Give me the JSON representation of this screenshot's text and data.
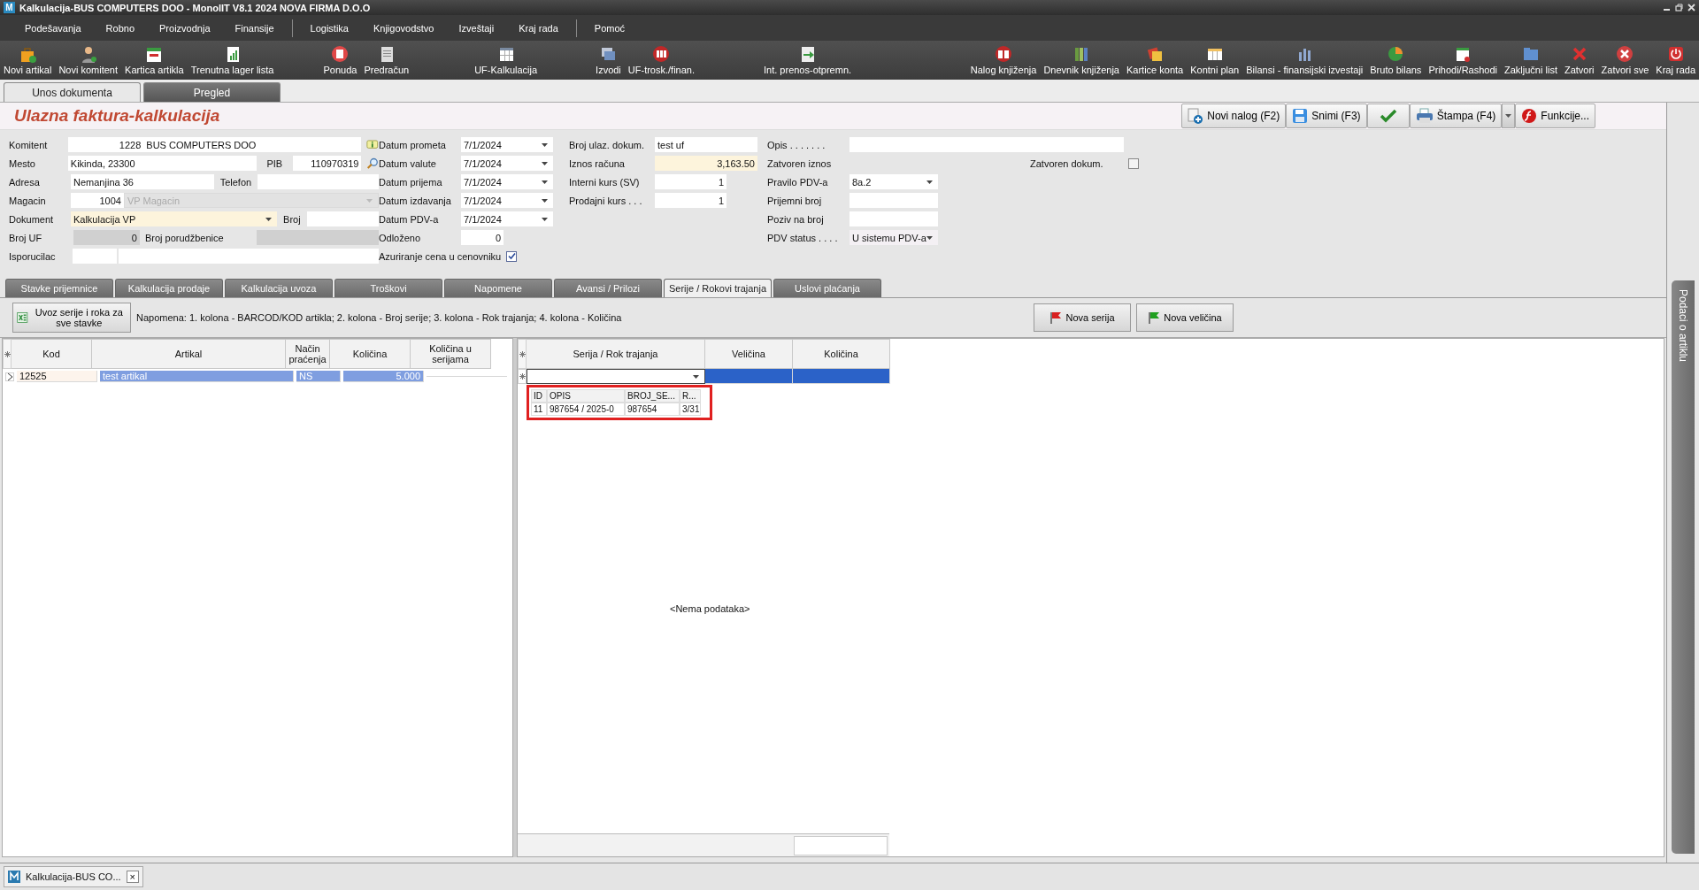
{
  "window": {
    "title": "Kalkulacija-BUS COMPUTERS DOO - MonolIT V8.1 2024 NOVA FIRMA D.O.O",
    "logo": "M"
  },
  "menu": [
    [
      "Podešavanja",
      "Robno",
      "Proizvodnja",
      "Finansije"
    ],
    [
      "Logistika",
      "Knjigovodstvo",
      "Izveštaji",
      "Kraj rada"
    ],
    [
      "Pomoć"
    ]
  ],
  "toolbar": [
    [
      "Novi artikal",
      "Novi komitent",
      "Kartica artikla",
      "Trenutna lager lista"
    ],
    [
      "Ponuda",
      "Predračun"
    ],
    [
      "UF-Kalkulacija"
    ],
    [
      "Izvodi",
      "UF-trosk./finan."
    ],
    [
      "Int. prenos-otpremn."
    ],
    [
      "Nalog knjiženja",
      "Dnevnik knjiženja",
      "Kartice konta",
      "Kontni plan",
      "Bilansi - finansijski izvestaji",
      "Bruto bilans",
      "Prihodi/Rashodi",
      "Zaključni list",
      "Zatvori",
      "Zatvori sve",
      "Kraj rada"
    ]
  ],
  "doc_tabs": [
    {
      "label": "Unos dokumenta",
      "selected": true
    },
    {
      "label": "Pregled",
      "selected": false
    }
  ],
  "header": {
    "title": "Ulazna faktura-kalkulacija",
    "buttons": [
      {
        "kind": "new",
        "label": "Novi nalog (F2)"
      },
      {
        "kind": "save",
        "label": "Snimi (F3)"
      },
      {
        "kind": "confirm"
      },
      {
        "kind": "print",
        "label": "Štampa (F4)"
      },
      {
        "kind": "functions",
        "label": "Funkcije..."
      }
    ]
  },
  "form": {
    "komitent": {
      "label": "Komitent",
      "code": "1228",
      "name": "BUS COMPUTERS DOO"
    },
    "mesto": {
      "label": "Mesto",
      "value": "Kikinda, 23300"
    },
    "pib": {
      "label": "PIB",
      "value": "110970319"
    },
    "adresa": {
      "label": "Adresa",
      "value": "Nemanjina 36"
    },
    "telefon": {
      "label": "Telefon"
    },
    "magacin": {
      "label": "Magacin",
      "code": "1004",
      "name": "VP Magacin",
      "disabled": true
    },
    "dokument": {
      "label": "Dokument",
      "value": "Kalkulacija VP"
    },
    "broj": {
      "label": "Broj"
    },
    "broj_uf": {
      "label": "Broj UF",
      "value": "0"
    },
    "broj_porudzbenice": {
      "label": "Broj porudžbenice"
    },
    "isporucilac": {
      "label": "Isporucilac"
    },
    "dates": [
      {
        "label": "Datum prometa",
        "value": "7/1/2024"
      },
      {
        "label": "Datum valute",
        "value": "7/1/2024"
      },
      {
        "label": "Datum prijema",
        "value": "7/1/2024"
      },
      {
        "label": "Datum izdavanja",
        "value": "7/1/2024"
      },
      {
        "label": "Datum PDV-a",
        "value": "7/1/2024"
      }
    ],
    "odlozeno": {
      "label": "Odloženo",
      "value": "0"
    },
    "azuriranje": {
      "label": "Azuriranje cena u cenovniku",
      "checked": true
    },
    "amounts": [
      {
        "label": "Broj ulaz. dokum.",
        "value": "test uf",
        "kind": "text"
      },
      {
        "label": "Iznos računa",
        "value": "3,163.50",
        "kind": "amount"
      },
      {
        "label": "Interni kurs (SV)",
        "value": "1",
        "kind": "number"
      },
      {
        "label": "Prodajni kurs . . .",
        "value": "1",
        "kind": "number"
      }
    ],
    "opis": {
      "label": "Opis . . . . . . ."
    },
    "zatvoren_iznos": {
      "label": "Zatvoren iznos"
    },
    "zatvoren_dokum": {
      "label": "Zatvoren dokum.",
      "checked": false
    },
    "pravilo": {
      "label": "Pravilo PDV-a",
      "value": "8a.2"
    },
    "prijemni_broj": {
      "label": "Prijemni broj"
    },
    "poziv_na_broj": {
      "label": "Poziv na broj"
    },
    "pdv_status": {
      "label": "PDV status . . . .",
      "value": "U sistemu PDV-a"
    }
  },
  "detail_tabs": [
    {
      "label": "Stavke  prijemnice",
      "selected": false
    },
    {
      "label": "Kalkulacija prodaje",
      "selected": false
    },
    {
      "label": "Kalkulacija uvoza",
      "selected": false
    },
    {
      "label": "Troškovi",
      "selected": false
    },
    {
      "label": "Napomene",
      "selected": false
    },
    {
      "label": "Avansi / Prilozi",
      "selected": false
    },
    {
      "label": "Serije / Rokovi trajanja",
      "selected": true
    },
    {
      "label": "Uslovi plaćanja",
      "selected": false
    }
  ],
  "import_button": "Uvoz serije i roka za sve stavke",
  "note": "Napomena: 1. kolona - BARCOD/KOD artikla; 2. kolona - Broj serije; 3. kolona - Rok trajanja; 4. kolona - Količina",
  "series_buttons": [
    "Nova serija",
    "Nova veličina"
  ],
  "items_table": {
    "columns": [
      "Kod",
      "Artikal",
      "Način praćenja",
      "Količina",
      "Količina u serijama"
    ],
    "rows": [
      {
        "cells": [
          "12525",
          "test artikal",
          "NS",
          "5.000",
          ""
        ],
        "selected": true
      }
    ]
  },
  "series_table": {
    "columns": [
      "Serija / Rok trajanja",
      "Veličina",
      "Količina"
    ],
    "dropdown": {
      "columns": [
        "ID",
        "OPIS",
        "BROJ_SE...",
        "R..."
      ],
      "rows": [
        [
          "11",
          "987654 / 2025-0",
          "987654",
          "3/31"
        ]
      ]
    },
    "empty": "<Nema podataka>"
  },
  "side_tab": "Podaci o artiklu",
  "taskbar": [
    {
      "label": "Kalkulacija-BUS CO...",
      "close": "×"
    }
  ]
}
